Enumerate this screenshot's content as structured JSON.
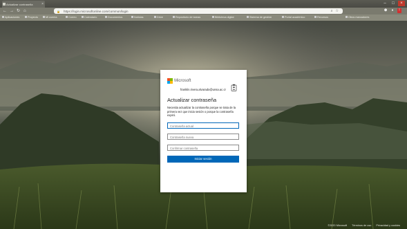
{
  "browser": {
    "tab_title": "Actualizar contraseña",
    "url": "https://login.microsoftonline.com/common/login",
    "bookmarks": [
      "Aplicaciones",
      "Proyecto",
      "Mi cuenta",
      "Correo",
      "Calendario",
      "Documentos",
      "Noticias",
      "Drive",
      "Repositorio de tareas",
      "Biblioteca digital",
      "Sistema de gestión",
      "Portal académico",
      "Recursos",
      "Otros marcadores"
    ]
  },
  "login": {
    "logo_text": "Microsoft",
    "account_email": "franklin.rivera.alvarado@unsa.ac.cr",
    "heading": "Actualizar contraseña",
    "description": "Necesita actualizar la contraseña porque se trata de la primera vez que inicia sesión o porque la contraseña expiró.",
    "current_password_placeholder": "Contraseña actual",
    "new_password_placeholder": "Contraseña nueva",
    "confirm_password_placeholder": "Confirmar contraseña",
    "submit_label": "Iniciar sesión"
  },
  "footer": {
    "copyright": "©2020 Microsoft",
    "terms": "Términos de uso",
    "privacy": "Privacidad y cookies"
  },
  "colors": {
    "accent": "#0067b8",
    "ms_red": "#f25022",
    "ms_green": "#7fba00",
    "ms_blue": "#00a4ef",
    "ms_yellow": "#ffb900"
  },
  "icons": [
    "back-icon",
    "forward-icon",
    "reload-icon",
    "home-icon",
    "lock-icon",
    "star-icon",
    "account-badge-icon"
  ]
}
